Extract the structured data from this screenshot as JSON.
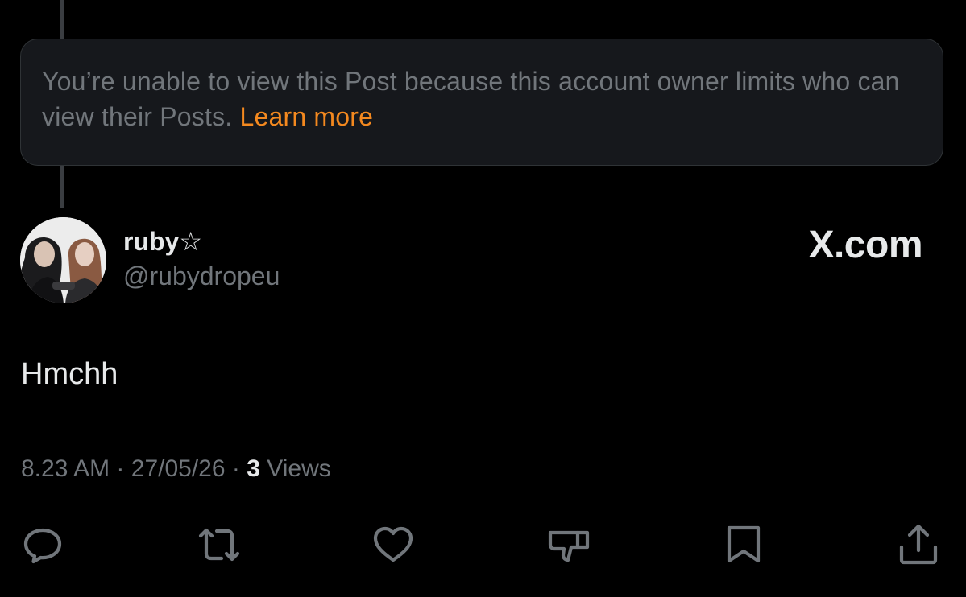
{
  "notice": {
    "text": "You’re unable to view this Post because this account owner limits who can view their Posts.",
    "link": "Learn more",
    "link_color": "#f4891f"
  },
  "author": {
    "display_name": "ruby☆",
    "handle": "@rubydropeu"
  },
  "site_logo": "X.com",
  "post": {
    "text": "Hmchh"
  },
  "meta": {
    "time": "8.23 AM",
    "separator": "·",
    "date": "27/05/26",
    "views_count": "3",
    "views_label": "Views"
  },
  "actions": [
    {
      "icon": "reply-icon"
    },
    {
      "icon": "repost-icon"
    },
    {
      "icon": "like-icon"
    },
    {
      "icon": "dislike-icon"
    },
    {
      "icon": "bookmark-icon"
    },
    {
      "icon": "share-icon"
    }
  ],
  "colors": {
    "background": "#000000",
    "text_primary": "#e7e9ea",
    "text_secondary": "#71767b",
    "card_background": "#16181c"
  }
}
